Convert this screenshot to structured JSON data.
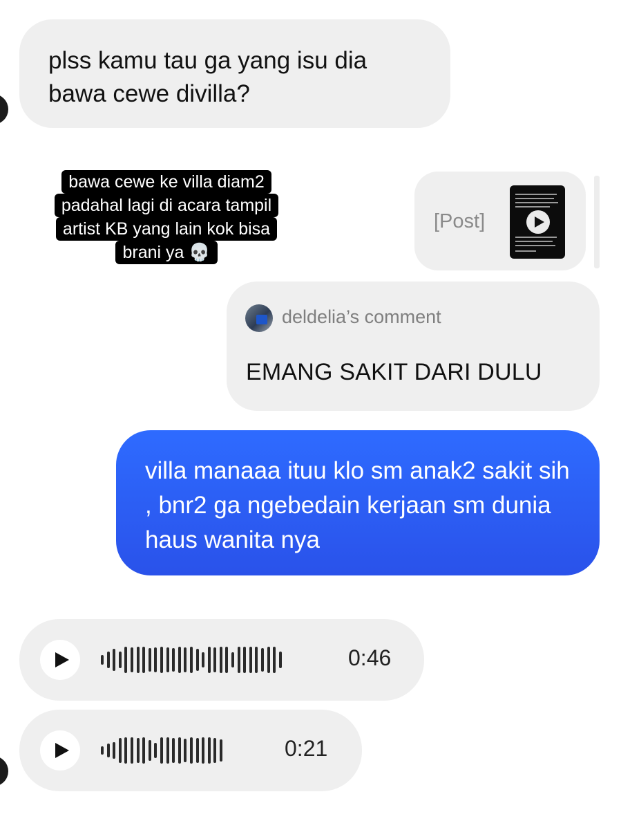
{
  "messages": {
    "incoming_1": "plss kamu tau ga yang isu dia bawa cewe divilla?",
    "story_reply_caption": [
      "bawa cewe ke villa diam2",
      "padahal lagi di acara tampil",
      "artist KB yang lain kok bisa",
      "brani ya 💀"
    ],
    "shared_post": {
      "label": "[Post]"
    },
    "comment": {
      "author": "deldelia’s comment",
      "text": "EMANG SAKIT DARI DULU"
    },
    "outgoing_1": "villa manaaa ituu klo sm anak2 sakit sih , bnr2 ga ngebedain kerjaan sm dunia haus wanita nya",
    "voice_notes": [
      {
        "duration": "0:46"
      },
      {
        "duration": "0:21"
      }
    ]
  },
  "colors": {
    "incoming_bubble": "#efefef",
    "outgoing_bubble": "#2e6bff",
    "caption_bg": "#000000"
  },
  "icons": [
    "play-icon",
    "skull-emoji",
    "avatar"
  ]
}
